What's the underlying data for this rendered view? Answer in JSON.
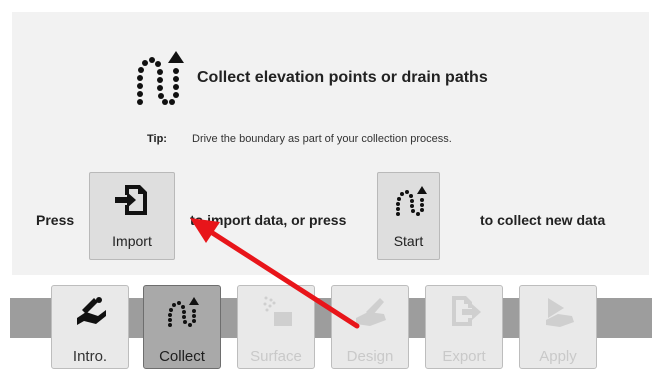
{
  "header": {
    "icon": "collect-path-icon",
    "title": "Collect elevation points or drain paths"
  },
  "tip": {
    "label": "Tip:",
    "text": "Drive the boundary as part of your collection process."
  },
  "instructions": {
    "press": "Press",
    "middle": "to import data, or press",
    "end": "to collect new data"
  },
  "buttons": {
    "import": {
      "label": "Import",
      "icon": "import-file-icon"
    },
    "start": {
      "label": "Start",
      "icon": "collect-path-icon"
    }
  },
  "tabs": [
    {
      "label": "Intro.",
      "icon": "intro-icon",
      "state": "enabled"
    },
    {
      "label": "Collect",
      "icon": "collect-path-icon",
      "state": "active"
    },
    {
      "label": "Surface",
      "icon": "surface-icon",
      "state": "disabled"
    },
    {
      "label": "Design",
      "icon": "design-icon",
      "state": "disabled"
    },
    {
      "label": "Export",
      "icon": "export-icon",
      "state": "disabled"
    },
    {
      "label": "Apply",
      "icon": "apply-icon",
      "state": "disabled"
    }
  ],
  "annotation": {
    "arrow_color": "#e8151a"
  }
}
